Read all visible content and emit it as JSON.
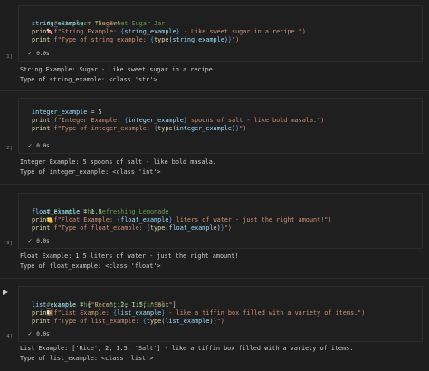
{
  "cells": [
    {
      "exec_count": "[1]",
      "lines": {
        "l1": "# # Strings: The Sweet Sugar Jar",
        "l1_emoji": "🍬",
        "l2_var": "string_example",
        "l2_eq": " = ",
        "l2_val": "\"Sugar\"",
        "l3_func": "print",
        "l3_a": "(f\"String Example: ",
        "l3_b": "{",
        "l3_c": "string_example",
        "l3_d": "}",
        "l3_e": " - Like sweet sugar in a recipe.\")",
        "l4_func": "print",
        "l4_a": "(f\"Type of string_example: ",
        "l4_b": "{",
        "l4_c": "type",
        "l4_d": "(",
        "l4_e": "string_example",
        "l4_f": ")",
        "l4_g": "}",
        "l4_h": "\")"
      },
      "time": "0.0s",
      "output": [
        "String Example: Sugar - Like sweet sugar in a recipe.",
        "Type of string_example: <class 'str'>"
      ]
    },
    {
      "exec_count": "[2]",
      "lines": {
        "l1_var": "integer_example",
        "l1_eq": " = ",
        "l1_val": "5",
        "l2_func": "print",
        "l2_a": "(f\"Integer Example: ",
        "l2_b": "{",
        "l2_c": "integer_example",
        "l2_d": "}",
        "l2_e": " spoons of salt - like bold masala.\")",
        "l3_func": "print",
        "l3_a": "(f\"Type of integer_example: ",
        "l3_b": "{",
        "l3_c": "type",
        "l3_d": "(",
        "l3_e": "integer_example",
        "l3_f": ")",
        "l3_g": "}",
        "l3_h": "\")"
      },
      "time": "0.0s",
      "output": [
        "Integer Example: 5 spoons of salt - like bold masala.",
        "Type of integer_example: <class 'int'>"
      ]
    },
    {
      "exec_count": "[3]",
      "lines": {
        "l1": "# Floats: The Refreshing Lemonade",
        "l1_emoji": "🍋",
        "l2_var": "float_example",
        "l2_eq": " = ",
        "l2_val": "1.5",
        "l3_func": "print",
        "l3_a": "(f\"Float Example: ",
        "l3_b": "{",
        "l3_c": "float_example",
        "l3_d": "}",
        "l3_e": " liters of water - just the right amount!\")",
        "l4_func": "print",
        "l4_a": "(f\"Type of float_example: ",
        "l4_b": "{",
        "l4_c": "type",
        "l4_d": "(",
        "l4_e": "float_example",
        "l4_f": ")",
        "l4_g": "}",
        "l4_h": "\")"
      },
      "time": "0.0s",
      "output": [
        "Float Example: 1.5 liters of water - just the right amount!",
        "Type of float_example: <class 'float'>"
      ]
    },
    {
      "exec_count": "[4]",
      "lines": {
        "l1": "# Lists: The Versatile Tiffin Box",
        "l1_emoji": "🍱",
        "l2_var": "list_example",
        "l2_eq": " = [",
        "l2_s1": "\"Rice\"",
        "l2_c1": ", ",
        "l2_n1": "2",
        "l2_c2": ", ",
        "l2_n2": "1.5",
        "l2_c3": ", ",
        "l2_s2": "\"Salt\"",
        "l2_end": "]",
        "l3_func": "print",
        "l3_a": "(f\"List Example: ",
        "l3_b": "{",
        "l3_c": "list_example",
        "l3_d": "}",
        "l3_e": " - like a tiffin box filled with a variety of items.\")",
        "l4_func": "print",
        "l4_a": "(f\"Type of list_example: ",
        "l4_b": "{",
        "l4_c": "type",
        "l4_d": "(",
        "l4_e": "list_example",
        "l4_f": ")",
        "l4_g": "}",
        "l4_h": "\")"
      },
      "time": "0.0s",
      "output": [
        "List Example: ['Rice', 2, 1.5, 'Salt'] - like a tiffin box filled with a variety of items.",
        "Type of list_example: <class 'list'>"
      ]
    }
  ],
  "icons": {
    "check": "✓",
    "run": "run-icon"
  },
  "colors": {
    "background": "#1e1e1e",
    "comment": "#6a9955",
    "variable": "#9cdcfe",
    "string": "#ce9178",
    "function": "#dcdcaa",
    "number": "#b5cea8",
    "check": "#89d185"
  }
}
